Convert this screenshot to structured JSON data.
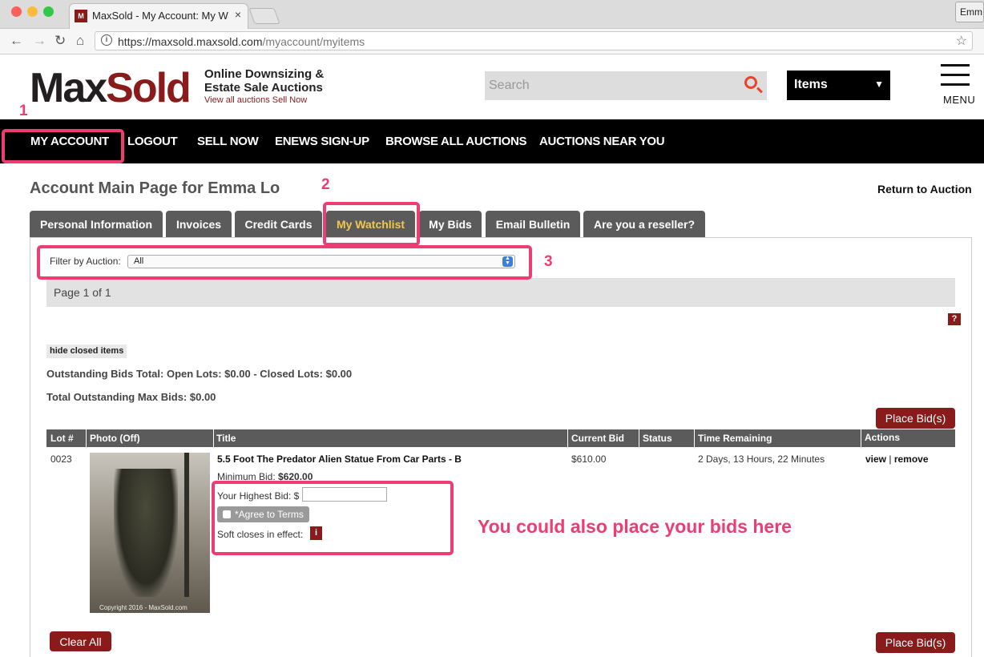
{
  "browser": {
    "tab_title": "MaxSold - My Account: My Wa",
    "tab_close": "×",
    "profile": "Emm",
    "url_domain": "https://maxsold.maxsold.com",
    "url_path": "/myaccount/myitems"
  },
  "header": {
    "logo_max": "Max",
    "logo_sold": "Sold",
    "tagline_1": "Online Downsizing &",
    "tagline_2": "Estate Sale Auctions",
    "link_view_all": "View all auctions",
    "link_sell_now": "Sell Now",
    "search_placeholder": "Search",
    "items_select": "Items",
    "menu_label": "MENU"
  },
  "nav": {
    "my_account": "MY ACCOUNT",
    "logout": "LOGOUT",
    "sell_now": "SELL NOW",
    "enews": "ENEWS SIGN-UP",
    "browse": "BROWSE ALL AUCTIONS",
    "near_you": "AUCTIONS NEAR YOU"
  },
  "annotations": {
    "num1": "1",
    "num2": "2",
    "num3": "3",
    "overlay": "You could also place your bids here"
  },
  "account": {
    "heading": "Account Main Page for Emma Lo",
    "return_link": "Return to Auction",
    "tabs": [
      "Personal Information",
      "Invoices",
      "Credit Cards",
      "My Watchlist",
      "My Bids",
      "Email Bulletin",
      "Are you a reseller?"
    ],
    "active_tab": "My Watchlist"
  },
  "watchlist": {
    "filter_label": "Filter by Auction:",
    "filter_value": "All",
    "page_text": "Page 1 of 1",
    "help": "?",
    "hide_closed": "hide closed items",
    "outstanding_total": "Outstanding Bids Total: Open Lots: $0.00 - Closed Lots: $0.00",
    "max_bids_total": "Total Outstanding Max Bids: $0.00",
    "place_bid": "Place Bid(s)",
    "clear_all": "Clear All",
    "columns": [
      "Lot #",
      "Photo (Off)",
      "Title",
      "Current Bid",
      "Status",
      "Time Remaining",
      "Actions"
    ],
    "rows": [
      {
        "lot": "0023",
        "title": "5.5 Foot The Predator Alien Statue From Car Parts - B",
        "min_bid_label": "Minimum Bid:",
        "min_bid": "$620.00",
        "highest_bid_label": "Your Highest Bid: $",
        "highest_bid_value": "",
        "agree": "*Agree to Terms",
        "soft_close": "Soft closes in effect:",
        "soft_close_icon": "i",
        "current_bid": "$610.00",
        "status": "",
        "time_remaining": "2 Days, 13 Hours, 22 Minutes",
        "action_view": "view",
        "action_sep": "|",
        "action_remove": "remove",
        "photo_caption": "Copyright 2016 - MaxSold.com"
      }
    ]
  },
  "colors": {
    "brand_red": "#8b1a1a",
    "annotation_pink": "#ec3e72",
    "active_tab_text": "#f3c64d"
  }
}
